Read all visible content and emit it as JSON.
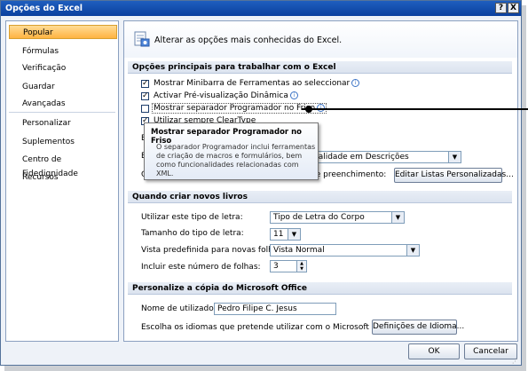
{
  "window": {
    "title": "Opções do Excel",
    "help": "?",
    "close": "X"
  },
  "sidebar": {
    "items": [
      {
        "label": "Popular",
        "selected": true
      },
      {
        "label": "Fórmulas"
      },
      {
        "label": "Verificação"
      },
      {
        "label": "Guardar"
      },
      {
        "label": "Avançadas"
      },
      {
        "label": "Personalizar"
      },
      {
        "label": "Suplementos"
      },
      {
        "label": "Centro de Fidedignidade"
      },
      {
        "label": "Recursos"
      }
    ]
  },
  "header": {
    "title": "Alterar as opções mais conhecidas do Excel."
  },
  "sections": {
    "top": {
      "heading": "Opções principais para trabalhar com o Excel",
      "options": [
        {
          "label": "Mostrar Minibarra de Ferramentas ao seleccionar",
          "checked": true
        },
        {
          "label": "Activar Pré-visualização Dinâmica",
          "checked": true
        },
        {
          "label": "Mostrar separador Programador no Friso",
          "checked": false
        },
        {
          "label": "Utilizar sempre ClearType",
          "checked": true
        }
      ],
      "partial_row_1": "E",
      "partial_row_2": "E",
      "partial_row_3": "C",
      "screentip_select_value": "nalidade em Descrições",
      "fill_lists_text": "de preenchimento:",
      "fill_lists_button": "Editar Listas Personalizadas..."
    },
    "new_books": {
      "heading": "Quando criar novos livros",
      "font_label": "Utilizar este tipo de letra:",
      "font_value": "Tipo de Letra do Corpo",
      "size_label": "Tamanho do tipo de letra:",
      "size_value": "11",
      "view_label": "Vista predefinida para novas folhas:",
      "view_value": "Vista Normal",
      "sheets_label": "Incluir este número de folhas:",
      "sheets_value": "3"
    },
    "office": {
      "heading": "Personalize a cópia do Microsoft Office",
      "user_label": "Nome de utilizador:",
      "user_value": "Pedro Filipe C. Jesus",
      "lang_label": "Escolha os idiomas que pretende utilizar com o Microsoft Office:",
      "lang_button": "Definições de Idioma..."
    }
  },
  "tooltip": {
    "title": "Mostrar separador Programador no Friso",
    "body": "O separador Programador inclui ferramentas de criação de macros e formulários, bem como funcionalidades relacionadas com XML."
  },
  "footer": {
    "ok": "OK",
    "cancel": "Cancelar"
  }
}
